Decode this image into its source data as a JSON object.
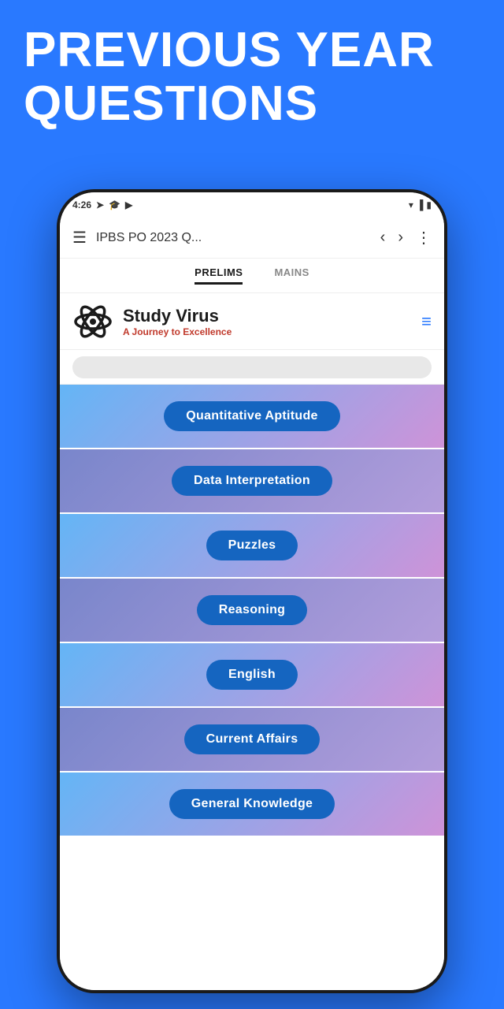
{
  "hero": {
    "title_line1": "PREVIOUS YEAR",
    "title_line2": "QUESTIONS"
  },
  "status_bar": {
    "time": "4:26",
    "icons_left": [
      "navigation",
      "graduation-cap",
      "mortarboard",
      "youtube"
    ],
    "icons_right": [
      "wifi",
      "signal",
      "battery"
    ]
  },
  "nav_bar": {
    "title": "IPBS PO 2023 Q...",
    "menu_icon": "☰",
    "back_icon": "‹",
    "forward_icon": "›",
    "more_icon": "⋮"
  },
  "tabs": [
    {
      "label": "PRELIMS",
      "active": true
    },
    {
      "label": "MAINS",
      "active": false
    }
  ],
  "logo": {
    "title": "Study Virus",
    "subtitle": "A Journey to Excellence",
    "hamburger": "≡"
  },
  "categories": [
    {
      "label": "Quantitative Aptitude"
    },
    {
      "label": "Data Interpretation"
    },
    {
      "label": "Puzzles"
    },
    {
      "label": "Reasoning"
    },
    {
      "label": "English"
    },
    {
      "label": "Current Affairs"
    },
    {
      "label": "General Knowledge"
    }
  ]
}
